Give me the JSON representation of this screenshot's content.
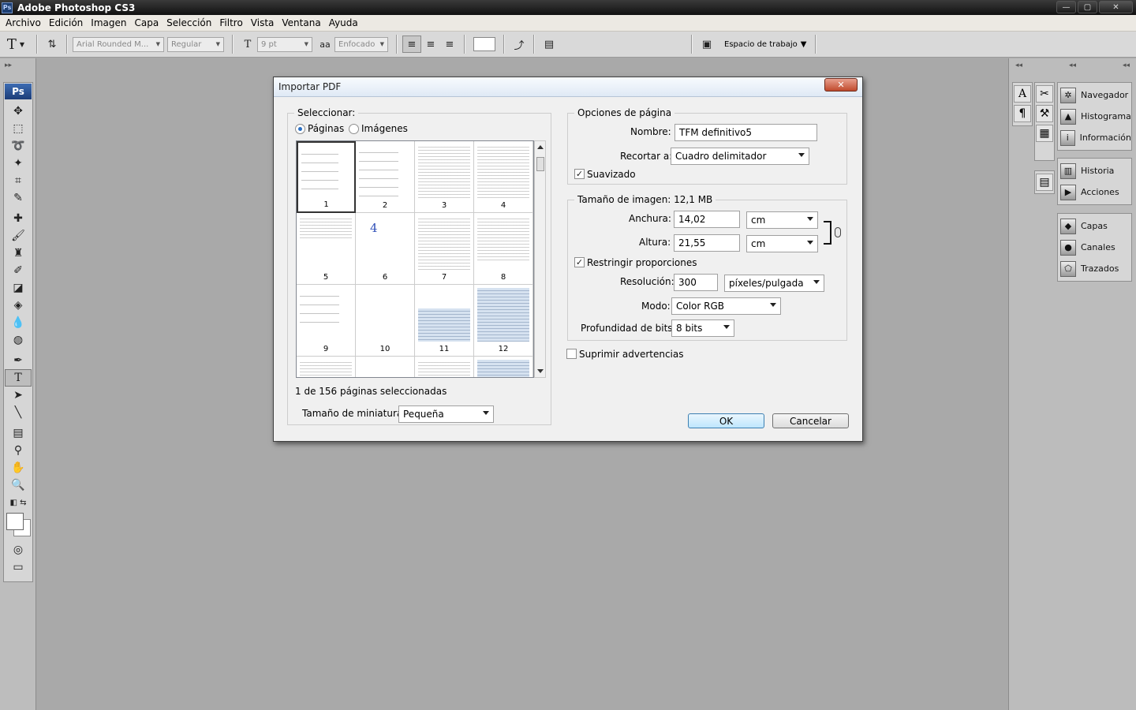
{
  "app": {
    "title": "Adobe Photoshop CS3",
    "ps_badge": "Ps"
  },
  "window_buttons": {
    "minimize": "—",
    "restore": "▢",
    "close": "✕"
  },
  "menu": [
    "Archivo",
    "Edición",
    "Imagen",
    "Capa",
    "Selección",
    "Filtro",
    "Vista",
    "Ventana",
    "Ayuda"
  ],
  "options": {
    "font_family": "Arial Rounded M...",
    "font_style": "Regular",
    "font_size": "9 pt",
    "antialias_icon": "aa",
    "antialias": "Enfocado",
    "workspace_label": "Espacio de trabajo"
  },
  "toolbox": {
    "logo": "Ps"
  },
  "panels": {
    "group1": [
      "Navegador",
      "Histograma",
      "Información"
    ],
    "group2": [
      "Historia",
      "Acciones"
    ],
    "group3": [
      "Capas",
      "Canales",
      "Trazados"
    ]
  },
  "dialog": {
    "title": "Importar PDF",
    "close_glyph": "✕",
    "select_label": "Seleccionar:",
    "radio_pages": "Páginas",
    "radio_images": "Imágenes",
    "thumbs": [
      "1",
      "2",
      "3",
      "4",
      "5",
      "6",
      "7",
      "8",
      "9",
      "10",
      "11",
      "12",
      "",
      "",
      "",
      ""
    ],
    "page6_big": "4",
    "status": "1 de 156 páginas seleccionadas",
    "thumb_size_label": "Tamaño de miniatura:",
    "thumb_size_value": "Pequeña",
    "page_options": {
      "legend": "Opciones de página",
      "name_label": "Nombre:",
      "name_value": "TFM definitivo5",
      "crop_label": "Recortar a:",
      "crop_value": "Cuadro delimitador",
      "antialias_label": "Suavizado",
      "antialias_checked": true
    },
    "image_size": {
      "legend": "Tamaño de imagen: 12,1 MB",
      "width_label": "Anchura:",
      "width_value": "14,02",
      "width_unit": "cm",
      "height_label": "Altura:",
      "height_value": "21,55",
      "height_unit": "cm",
      "constrain_label": "Restringir proporciones",
      "constrain_checked": true,
      "resolution_label": "Resolución:",
      "resolution_value": "300",
      "resolution_unit": "píxeles/pulgada",
      "mode_label": "Modo:",
      "mode_value": "Color RGB",
      "depth_label": "Profundidad de bits:",
      "depth_value": "8 bits"
    },
    "suppress_label": "Suprimir advertencias",
    "ok": "OK",
    "cancel": "Cancelar"
  }
}
